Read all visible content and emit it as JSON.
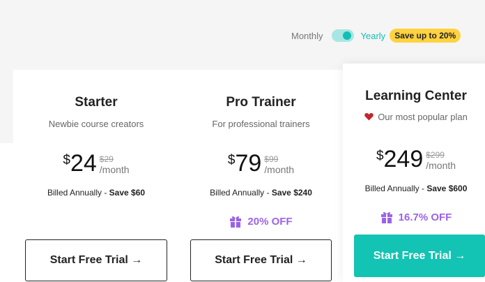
{
  "toggle": {
    "monthly_label": "Monthly",
    "yearly_label": "Yearly",
    "badge": "Save up to 20%",
    "state": "yearly"
  },
  "plans": [
    {
      "name": "Starter",
      "subtitle": "Newbie course creators",
      "currency": "$",
      "price": "24",
      "old_price": "$29",
      "period": "/month",
      "billed_prefix": "Billed Annually - ",
      "billed_save": "Save $60",
      "cta": "Start Free Trial →"
    },
    {
      "name": "Pro Trainer",
      "subtitle": "For professional trainers",
      "currency": "$",
      "price": "79",
      "old_price": "$99",
      "period": "/month",
      "billed_prefix": "Billed Annually - ",
      "billed_save": "Save $240",
      "discount": "20% OFF",
      "cta": "Start Free Trial →"
    },
    {
      "name": "Learning Center",
      "tagline": "Our most popular plan",
      "currency": "$",
      "price": "249",
      "old_price": "$299",
      "period": "/month",
      "billed_prefix": "Billed Annually - ",
      "billed_save": "Save $600",
      "discount": "16.7% OFF",
      "cta": "Start Free Trial →"
    }
  ],
  "colors": {
    "accent": "#13c3b3",
    "badge": "#ffd23f",
    "discount": "#9b62e8",
    "heart": "#c0282d"
  },
  "icons": [
    "heart-icon",
    "gift-icon",
    "arrow-right-icon"
  ]
}
